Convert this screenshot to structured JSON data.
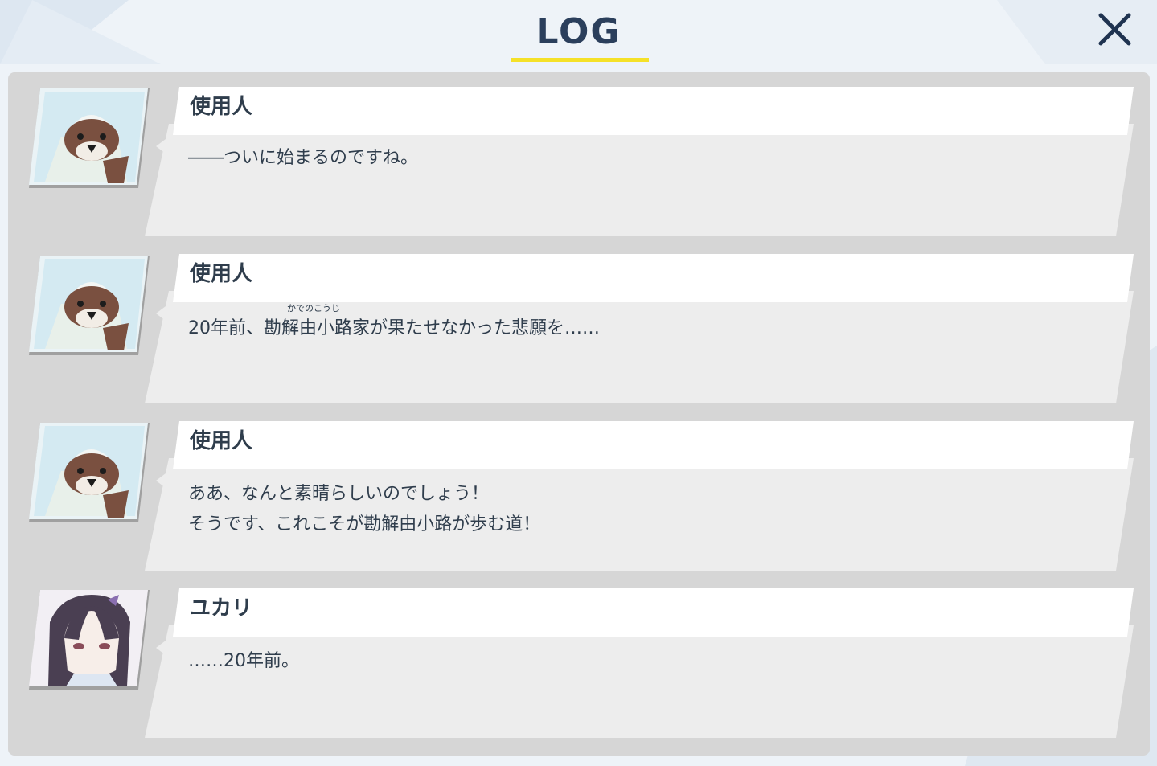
{
  "header": {
    "title": "LOG",
    "close_icon": "close-icon"
  },
  "entries": [
    {
      "speaker": "使用人",
      "avatar": "servant-bird-portrait",
      "lines": [
        "――ついに始まるのですね。"
      ]
    },
    {
      "speaker": "使用人",
      "avatar": "servant-bird-portrait",
      "lines": [
        "20年前、勘解由小路家が果たせなかった悲願を……"
      ],
      "ruby": "かでのこうじ"
    },
    {
      "speaker": "使用人",
      "avatar": "servant-bird-portrait",
      "lines": [
        "ああ、なんと素晴らしいのでしょう！",
        "そうです、これこそが勘解由小路が歩む道！"
      ]
    },
    {
      "speaker": "ユカリ",
      "avatar": "yukari-portrait",
      "lines": [
        "……20年前。"
      ]
    }
  ],
  "colors": {
    "title": "#2b3f5c",
    "accent": "#f5e128",
    "panel": "#d6d6d6",
    "bubble": "#ededed",
    "name_card": "#ffffff"
  }
}
